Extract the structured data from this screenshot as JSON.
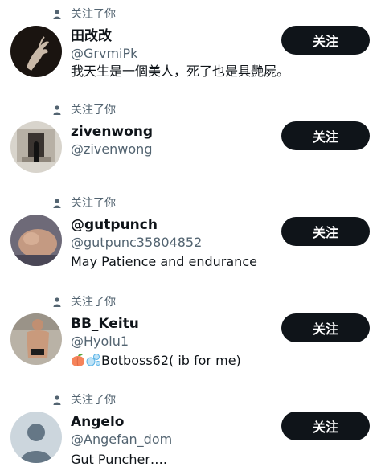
{
  "follow_label": "关注",
  "followed_you_label": "关注了你",
  "users": [
    {
      "display_name": "田改改",
      "handle": "@GrvmiPk",
      "bio": "我天生是一個美人，死了也是具艷屍。"
    },
    {
      "display_name": "zivenwong",
      "handle": "@zivenwong",
      "bio": ""
    },
    {
      "display_name": "@gutpunch",
      "handle": "@gutpunc35804852",
      "bio": "May Patience and endurance"
    },
    {
      "display_name": "BB_Keitu",
      "handle": "@Hyolu1",
      "bio": "Botboss62( ib for me)",
      "bio_emojis": [
        "peach-emoji",
        "bubbles-emoji"
      ]
    },
    {
      "display_name": "Angelo",
      "handle": "@Angefan_dom",
      "bio": "Gut Puncher…."
    }
  ],
  "colors": {
    "text_primary": "#0f1419",
    "text_secondary": "#536471",
    "button_bg": "#0f1419",
    "button_text": "#ffffff"
  }
}
